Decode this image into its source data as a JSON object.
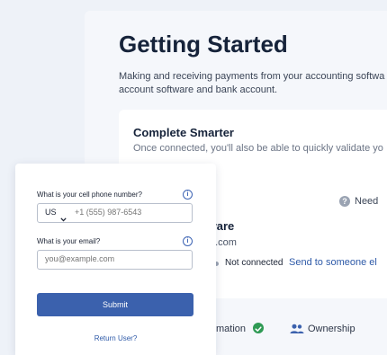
{
  "main": {
    "title": "Getting Started",
    "subtitle_line1": "Making and receiving payments from your accounting softwa",
    "subtitle_line2": "account software and bank account.",
    "card": {
      "title": "Complete Smarter",
      "text": "Once connected, you'll also be able to quickly validate yo",
      "help_label": "Need",
      "integration_name": "ftware",
      "integration_email": "nail.com",
      "status": "Not connected",
      "send_link": "Send to someone el"
    },
    "steps": [
      {
        "label": "mation"
      },
      {
        "label": "Ownership"
      }
    ]
  },
  "modal": {
    "phone_label": "What is your cell phone number?",
    "country_code": "US",
    "phone_placeholder": "+1 (555) 987-6543",
    "email_label": "What is your email?",
    "email_placeholder": "you@example.com",
    "submit_label": "Submit",
    "return_label": "Return User?"
  },
  "colors": {
    "accent": "#3b61ad",
    "link": "#2e5aa8",
    "success": "#2f9a54"
  }
}
